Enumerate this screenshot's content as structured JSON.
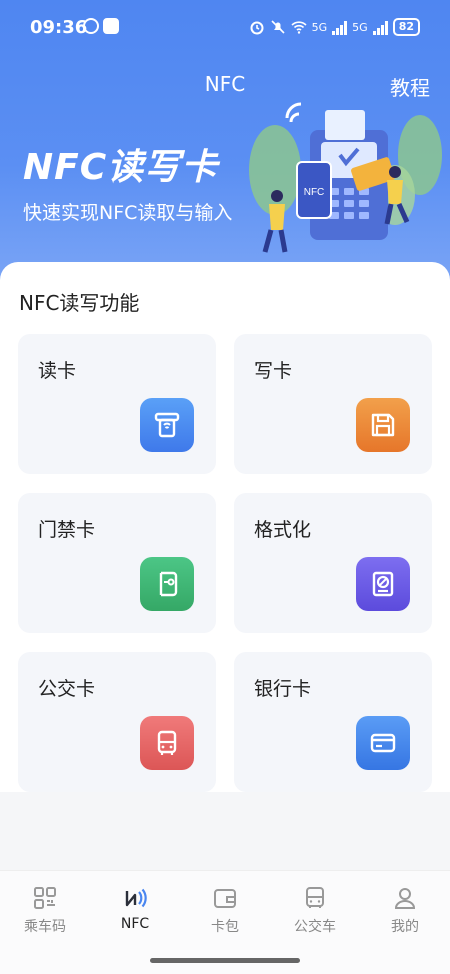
{
  "status_bar": {
    "time": "09:36",
    "network_left": "5G",
    "network_right": "5G",
    "battery": "82"
  },
  "header": {
    "title": "NFC",
    "tutorial_label": "教程"
  },
  "hero": {
    "title": "NFC读写卡",
    "subtitle": "快速实现NFC读取与输入",
    "illustration_text": "NFC"
  },
  "main": {
    "section_title": "NFC读写功能",
    "cards": [
      {
        "label": "读卡",
        "icon": "card-reader-icon",
        "color": "#4a86f0"
      },
      {
        "label": "写卡",
        "icon": "save-icon",
        "color": "#ef8a3a"
      },
      {
        "label": "门禁卡",
        "icon": "access-card-icon",
        "color": "#3fb873"
      },
      {
        "label": "格式化",
        "icon": "format-icon",
        "color": "#6b5ce7"
      },
      {
        "label": "公交卡",
        "icon": "bus-icon",
        "color": "#e96767"
      },
      {
        "label": "银行卡",
        "icon": "bank-card-icon",
        "color": "#3f83ea"
      }
    ]
  },
  "tabbar": {
    "items": [
      {
        "label": "乘车码",
        "icon": "qr-code-icon"
      },
      {
        "label": "NFC",
        "icon": "nfc-icon",
        "active": true
      },
      {
        "label": "卡包",
        "icon": "wallet-icon"
      },
      {
        "label": "公交车",
        "icon": "bus-icon"
      },
      {
        "label": "我的",
        "icon": "profile-icon"
      }
    ]
  }
}
